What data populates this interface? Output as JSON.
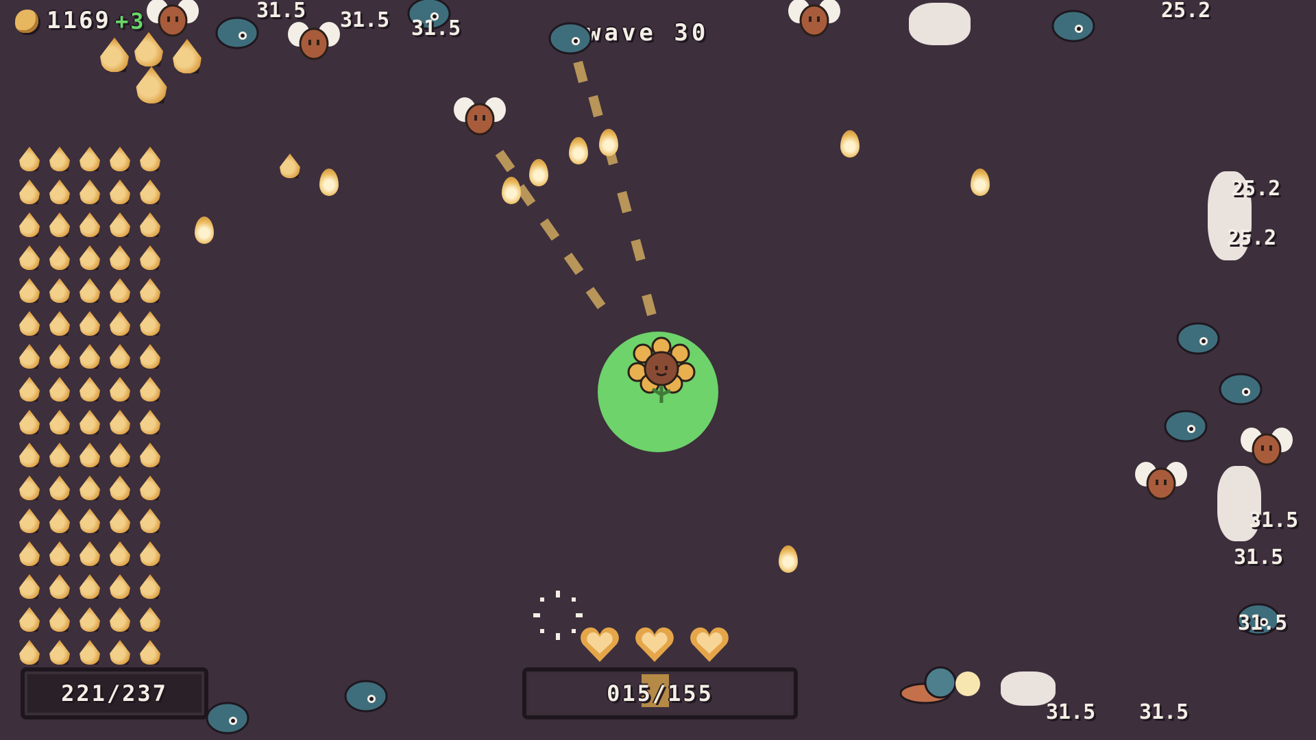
{
  "hud": {
    "coins": "1169",
    "coin_gain": "+3",
    "wave": "wave 30",
    "seed_capacity": "221/237",
    "xp": "015/155",
    "hearts": 3
  },
  "damage_numbers": [
    "31.5",
    "31.5",
    "31.5",
    "25.2",
    "25.2",
    "25.2",
    "31.5",
    "31.5",
    "31.5",
    "31.5",
    "31.5",
    "31.5",
    "31.5"
  ],
  "icons": {
    "coin": "coin-icon",
    "heart": "heart-icon",
    "seed": "seed-icon",
    "player": "sunflower-player",
    "aim": "crosshair-icon"
  },
  "colors": {
    "background": "#3d2f3c",
    "aura": "#6dd36a",
    "seed": "#e7b760",
    "gain": "#69d46a"
  }
}
